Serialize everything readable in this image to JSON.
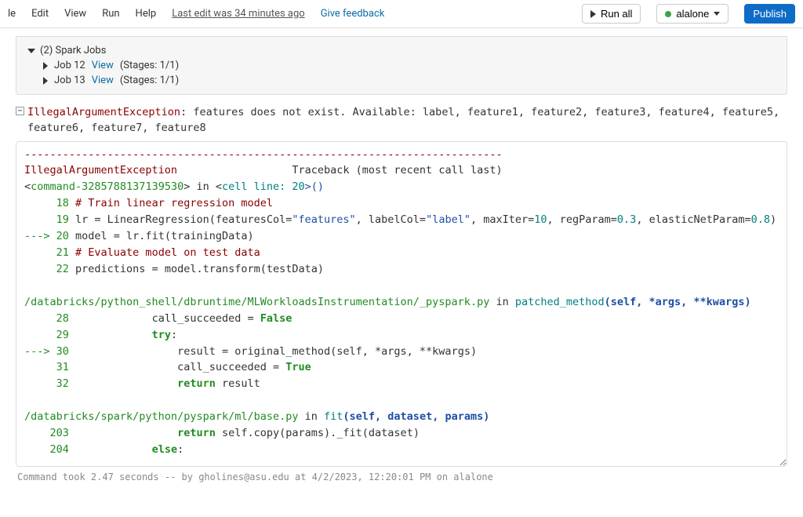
{
  "menu": {
    "file": "le",
    "edit": "Edit",
    "view": "View",
    "run": "Run",
    "help": "Help"
  },
  "last_edit": "Last edit was 34 minutes ago",
  "feedback": "Give feedback",
  "run_all": "Run all",
  "cluster_name": "alalone",
  "publish": "Publish",
  "spark": {
    "header": "(2) Spark Jobs",
    "jobs": [
      {
        "label": "Job 12",
        "view": "View",
        "stages": "(Stages: 1/1)"
      },
      {
        "label": "Job 13",
        "view": "View",
        "stages": "(Stages: 1/1)"
      }
    ]
  },
  "error": {
    "name": "IllegalArgumentException",
    "msg": ": features does not exist. Available: label, feature1, feature2, feature3, feature4, feature5, feature6, feature7, feature8"
  },
  "trace": {
    "dashes": "---------------------------------------------------------------------------",
    "head_exc": "IllegalArgumentException",
    "head_rest": "                  Traceback (most recent call last)",
    "line_cmd_pre": "<",
    "line_cmd_part": "command-3285788137139530",
    "line_cmd_mid": "> in <",
    "line_cmd_cell": "cell line: 20",
    "line_cmd_post": ">()",
    "l18_n": "     18 ",
    "l18_c": "# Train linear regression model",
    "l19_n": "     19 ",
    "l19_code_a": "lr = LinearRegression(featuresCol=",
    "l19_s1": "\"features\"",
    "l19_m1": ", labelCol=",
    "l19_s2": "\"label\"",
    "l19_m2": ", maxIter=",
    "l19_n1": "10",
    "l19_m3": ", regParam=",
    "l19_n2": "0.3",
    "l19_m4": ", elasticNetParam=",
    "l19_n3": "0.8",
    "l19_m5": ")",
    "l20_arrow": "---> ",
    "l20_n": "20 ",
    "l20_code": "model = lr.fit(trainingData)",
    "l21_n": "     21 ",
    "l21_c": "# Evaluate model on test data",
    "l22_n": "     22 ",
    "l22_code": "predictions = model.transform(testData)",
    "frame1_path": "/databricks/python_shell/dbruntime/MLWorkloadsInstrumentation/_pyspark.py",
    "frame1_in": " in ",
    "frame1_fn": "patched_method",
    "frame1_sig": "(self, *args, **kwargs)",
    "f1_28_n": "     28 ",
    "f1_28_code_a": "            call_succeeded = ",
    "f1_28_false": "False",
    "f1_29_n": "     29 ",
    "f1_29_code_a": "            ",
    "f1_29_try": "try",
    "f1_29_colon": ":",
    "f1_30_arrow": "---> ",
    "f1_30_n": "30 ",
    "f1_30_code": "                result = original_method(self, *args, **kwargs)",
    "f1_31_n": "     31 ",
    "f1_31_code_a": "                call_succeeded = ",
    "f1_31_true": "True",
    "f1_32_n": "     32 ",
    "f1_32_a": "                ",
    "f1_32_ret": "return",
    "f1_32_b": " result",
    "frame2_path": "/databricks/spark/python/pyspark/ml/base.py",
    "frame2_in": " in ",
    "frame2_fn": "fit",
    "frame2_sig": "(self, dataset, params)",
    "f2_203_n": "    203 ",
    "f2_203_a": "                ",
    "f2_203_ret": "return",
    "f2_203_b": " self.copy(params)._fit(dataset)",
    "f2_204_n": "    204 ",
    "f2_204_a": "            ",
    "f2_204_else": "else",
    "f2_204_colon": ":"
  },
  "status": "Command took 2.47 seconds -- by gholines@asu.edu at 4/2/2023, 12:20:01 PM on alalone"
}
